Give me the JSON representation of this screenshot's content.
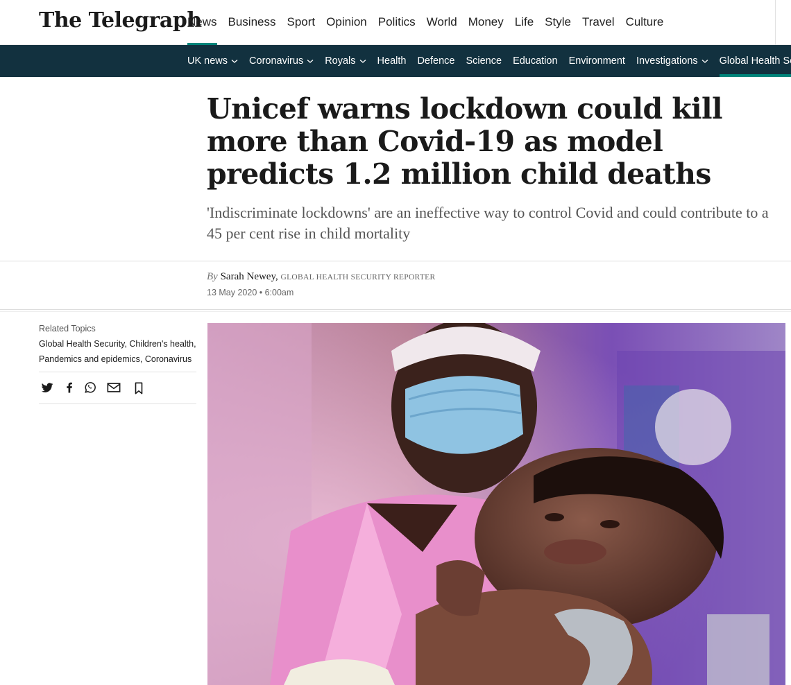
{
  "masthead": {
    "logo": "The Telegraph",
    "nav": [
      {
        "label": "News",
        "active": true
      },
      {
        "label": "Business"
      },
      {
        "label": "Sport"
      },
      {
        "label": "Opinion"
      },
      {
        "label": "Politics"
      },
      {
        "label": "World"
      },
      {
        "label": "Money"
      },
      {
        "label": "Life"
      },
      {
        "label": "Style"
      },
      {
        "label": "Travel"
      },
      {
        "label": "Culture"
      }
    ]
  },
  "subnav": {
    "items": [
      {
        "label": "UK news",
        "dropdown": true
      },
      {
        "label": "Coronavirus",
        "dropdown": true
      },
      {
        "label": "Royals",
        "dropdown": true
      },
      {
        "label": "Health"
      },
      {
        "label": "Defence"
      },
      {
        "label": "Science"
      },
      {
        "label": "Education"
      },
      {
        "label": "Environment"
      },
      {
        "label": "Investigations",
        "dropdown": true
      },
      {
        "label": "Global Health Security",
        "active": true
      }
    ]
  },
  "article": {
    "headline": "Unicef warns lockdown could kill more than Covid-19 as model predicts 1.2 million child deaths",
    "standfirst": "'Indiscriminate lockdowns' are an ineffective way to control Covid and could contribute to a 45 per cent rise in child mortality",
    "byline": {
      "prefix": "By",
      "author": "Sarah Newey,",
      "role": "GLOBAL HEALTH SECURITY REPORTER"
    },
    "date": "13 May 2020 • 6:00am"
  },
  "related": {
    "label": "Related Topics",
    "topics": [
      "Global Health Security",
      "Children's health",
      "Pandemics and epidemics",
      "Coronavirus"
    ]
  },
  "share": {
    "icons": [
      "twitter-icon",
      "facebook-icon",
      "whatsapp-icon",
      "email-icon",
      "bookmark-icon"
    ]
  },
  "colors": {
    "accent": "#00857b",
    "subnav_bg": "#12313f"
  }
}
